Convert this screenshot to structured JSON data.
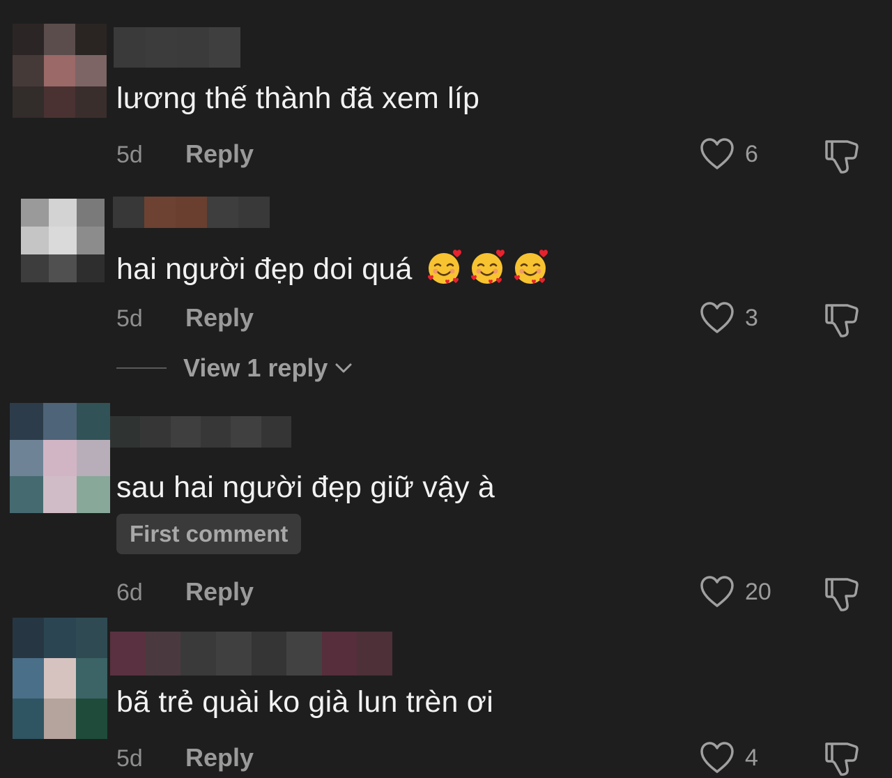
{
  "comments": [
    {
      "text": "lương thế thành đã xem líp",
      "time": "5d",
      "reply_label": "Reply",
      "likes": "6",
      "avatar_colors": [
        "#2b2625",
        "#5b4d4b",
        "#2a2523",
        "#463a39",
        "#9b6968",
        "#7d6565",
        "#322c2b",
        "#4a3232",
        "#3a2e2d"
      ],
      "username_colors": [
        "#3a3a3a",
        "#3c3c3c",
        "#3b3b3b",
        "#3f3f3f"
      ]
    },
    {
      "text": "hai người đẹp doi quá",
      "emoji_count": 3,
      "emoji_name": "smiling-face-with-hearts",
      "time": "5d",
      "reply_label": "Reply",
      "likes": "3",
      "view_replies_label": "View 1 reply",
      "avatar_colors": [
        "#9a9a9a",
        "#d3d3d3",
        "#7a7a7a",
        "#c5c5c5",
        "#dadada",
        "#8c8c8c",
        "#3d3d3d",
        "#505050",
        "#2e2e2e"
      ],
      "username_colors": [
        "#383838",
        "#6d4232",
        "#6a3f30",
        "#3e3e3e",
        "#393939"
      ]
    },
    {
      "text": "sau hai người đẹp giữ vậy à",
      "badge": "First comment",
      "time": "6d",
      "reply_label": "Reply",
      "likes": "20",
      "avatar_colors": [
        "#2c3c4a",
        "#4e6478",
        "#315256",
        "#6e8396",
        "#d2b5c5",
        "#b7aeba",
        "#456b70",
        "#d0bcc6",
        "#88a89a"
      ],
      "username_colors": [
        "#2f3432",
        "#363636",
        "#3f3f3f",
        "#373737",
        "#404040",
        "#353535"
      ]
    },
    {
      "text": "bã trẻ quài ko già lun trèn ơi",
      "time": "5d",
      "reply_label": "Reply",
      "likes": "4",
      "avatar_colors": [
        "#263743",
        "#2c4553",
        "#2f4a52",
        "#4a6f88",
        "#d6c3c0",
        "#3c6365",
        "#2f5462",
        "#b5a39d",
        "#1e4b3a"
      ],
      "username_colors": [
        "#5a3140",
        "#4a3a3f",
        "#3a3a3a",
        "#404040",
        "#353535",
        "#424242",
        "#562e3c",
        "#4d3038"
      ]
    }
  ],
  "colors": {
    "background": "#1e1e1e",
    "text": "#f2f2f2",
    "muted": "#8e8e8e",
    "badge_bg": "#3a3a3a"
  }
}
